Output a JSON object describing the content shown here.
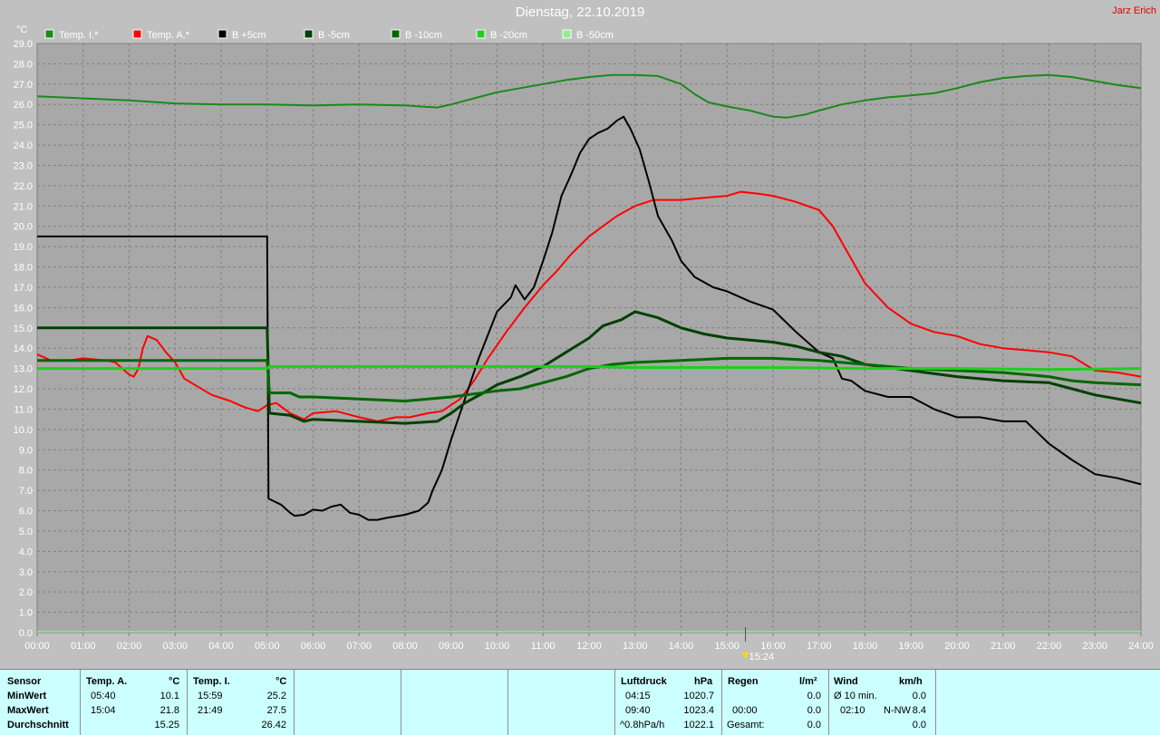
{
  "header": {
    "title": "Dienstag, 22.10.2019",
    "author": "Jarz Erich"
  },
  "colors": {
    "background": "#c0c0c0",
    "plot_bg": "#a8a8a8",
    "grid": "#808080",
    "stats_bg": "#ccffff"
  },
  "chart_data": {
    "type": "line",
    "y_unit": "°C",
    "ylim": [
      0,
      29
    ],
    "y_ticks": [
      "0.0",
      "1.0",
      "2.0",
      "3.0",
      "4.0",
      "5.0",
      "6.0",
      "7.0",
      "8.0",
      "9.0",
      "10.0",
      "11.0",
      "12.0",
      "13.0",
      "14.0",
      "15.0",
      "16.0",
      "17.0",
      "18.0",
      "19.0",
      "20.0",
      "21.0",
      "22.0",
      "23.0",
      "24.0",
      "25.0",
      "26.0",
      "27.0",
      "28.0",
      "29.0"
    ],
    "xlim": [
      0,
      24
    ],
    "x_ticks": [
      "00:00",
      "01:00",
      "02:00",
      "03:00",
      "04:00",
      "05:00",
      "06:00",
      "07:00",
      "08:00",
      "09:00",
      "10:00",
      "11:00",
      "12:00",
      "13:00",
      "14:00",
      "15:00",
      "16:00",
      "17:00",
      "18:00",
      "19:00",
      "20:00",
      "21:00",
      "22:00",
      "23:00",
      "24:00"
    ],
    "grid": true,
    "cursor": {
      "x": 15.4,
      "label": "15:24"
    },
    "legend": [
      {
        "name": "Temp. I.*",
        "color": "#1a8a1a"
      },
      {
        "name": "Temp. A.*",
        "color": "#ff0000"
      },
      {
        "name": "B +5cm",
        "color": "#000000"
      },
      {
        "name": "B -5cm",
        "color": "#004000"
      },
      {
        "name": "B -10cm",
        "color": "#006800"
      },
      {
        "name": "B -20cm",
        "color": "#1ecf1e"
      },
      {
        "name": "B -50cm",
        "color": "#90ee90"
      }
    ],
    "series": [
      {
        "name": "Temp. I.*",
        "color": "#1a8a1a",
        "width": 2,
        "points": [
          [
            0,
            26.4
          ],
          [
            0.5,
            26.35
          ],
          [
            1,
            26.3
          ],
          [
            2,
            26.2
          ],
          [
            3,
            26.05
          ],
          [
            4,
            26.0
          ],
          [
            5,
            26.0
          ],
          [
            6,
            25.95
          ],
          [
            7,
            26.0
          ],
          [
            8,
            25.95
          ],
          [
            8.7,
            25.85
          ],
          [
            9,
            26.0
          ],
          [
            9.5,
            26.3
          ],
          [
            10,
            26.6
          ],
          [
            10.5,
            26.8
          ],
          [
            11,
            27.0
          ],
          [
            11.5,
            27.2
          ],
          [
            12,
            27.35
          ],
          [
            12.5,
            27.45
          ],
          [
            13,
            27.45
          ],
          [
            13.5,
            27.4
          ],
          [
            14,
            27.0
          ],
          [
            14.3,
            26.5
          ],
          [
            14.6,
            26.1
          ],
          [
            15,
            25.9
          ],
          [
            15.5,
            25.7
          ],
          [
            16,
            25.4
          ],
          [
            16.3,
            25.35
          ],
          [
            16.7,
            25.5
          ],
          [
            17,
            25.7
          ],
          [
            17.5,
            26.0
          ],
          [
            18,
            26.2
          ],
          [
            18.5,
            26.35
          ],
          [
            19,
            26.45
          ],
          [
            19.5,
            26.55
          ],
          [
            20,
            26.8
          ],
          [
            20.5,
            27.1
          ],
          [
            21,
            27.3
          ],
          [
            21.5,
            27.4
          ],
          [
            22,
            27.45
          ],
          [
            22.5,
            27.35
          ],
          [
            23,
            27.15
          ],
          [
            23.5,
            26.95
          ],
          [
            24,
            26.8
          ]
        ]
      },
      {
        "name": "Temp. A.*",
        "color": "#ff0000",
        "width": 2,
        "points": [
          [
            0,
            13.7
          ],
          [
            0.3,
            13.4
          ],
          [
            0.7,
            13.4
          ],
          [
            1,
            13.5
          ],
          [
            1.5,
            13.4
          ],
          [
            1.7,
            13.3
          ],
          [
            2,
            12.7
          ],
          [
            2.1,
            12.6
          ],
          [
            2.2,
            13.0
          ],
          [
            2.3,
            14.0
          ],
          [
            2.4,
            14.6
          ],
          [
            2.6,
            14.4
          ],
          [
            2.8,
            13.8
          ],
          [
            3,
            13.3
          ],
          [
            3.2,
            12.5
          ],
          [
            3.5,
            12.1
          ],
          [
            3.8,
            11.7
          ],
          [
            4.2,
            11.4
          ],
          [
            4.5,
            11.1
          ],
          [
            4.8,
            10.9
          ],
          [
            5,
            11.2
          ],
          [
            5.2,
            11.3
          ],
          [
            5.5,
            10.8
          ],
          [
            5.8,
            10.5
          ],
          [
            6,
            10.8
          ],
          [
            6.5,
            10.9
          ],
          [
            7,
            10.6
          ],
          [
            7.4,
            10.4
          ],
          [
            7.8,
            10.6
          ],
          [
            8.1,
            10.6
          ],
          [
            8.5,
            10.8
          ],
          [
            8.8,
            10.9
          ],
          [
            9.2,
            11.5
          ],
          [
            9.5,
            12.4
          ],
          [
            9.8,
            13.5
          ],
          [
            10.2,
            14.8
          ],
          [
            10.6,
            16.0
          ],
          [
            11,
            17.1
          ],
          [
            11.3,
            17.8
          ],
          [
            11.6,
            18.6
          ],
          [
            12,
            19.5
          ],
          [
            12.3,
            20.0
          ],
          [
            12.6,
            20.5
          ],
          [
            13,
            21.0
          ],
          [
            13.4,
            21.3
          ],
          [
            14,
            21.3
          ],
          [
            14.5,
            21.4
          ],
          [
            15,
            21.5
          ],
          [
            15.3,
            21.7
          ],
          [
            15.7,
            21.6
          ],
          [
            16,
            21.5
          ],
          [
            16.5,
            21.2
          ],
          [
            17,
            20.8
          ],
          [
            17.3,
            20.0
          ],
          [
            17.6,
            18.8
          ],
          [
            18,
            17.2
          ],
          [
            18.5,
            16.0
          ],
          [
            19,
            15.2
          ],
          [
            19.5,
            14.8
          ],
          [
            20,
            14.6
          ],
          [
            20.5,
            14.2
          ],
          [
            21,
            14.0
          ],
          [
            21.5,
            13.9
          ],
          [
            22,
            13.8
          ],
          [
            22.5,
            13.6
          ],
          [
            23,
            12.9
          ],
          [
            23.5,
            12.8
          ],
          [
            24,
            12.6
          ]
        ]
      },
      {
        "name": "B +5cm",
        "color": "#000000",
        "width": 2,
        "points": [
          [
            0,
            19.5
          ],
          [
            5,
            19.5
          ],
          [
            5.03,
            6.6
          ],
          [
            5.3,
            6.3
          ],
          [
            5.5,
            5.9
          ],
          [
            5.6,
            5.75
          ],
          [
            5.8,
            5.8
          ],
          [
            6,
            6.05
          ],
          [
            6.2,
            6.0
          ],
          [
            6.4,
            6.2
          ],
          [
            6.6,
            6.3
          ],
          [
            6.8,
            5.9
          ],
          [
            7,
            5.8
          ],
          [
            7.2,
            5.55
          ],
          [
            7.4,
            5.55
          ],
          [
            7.6,
            5.65
          ],
          [
            8,
            5.8
          ],
          [
            8.3,
            6.0
          ],
          [
            8.5,
            6.4
          ],
          [
            8.6,
            7.0
          ],
          [
            8.8,
            8.0
          ],
          [
            9,
            9.5
          ],
          [
            9.3,
            11.5
          ],
          [
            9.6,
            13.5
          ],
          [
            10,
            15.8
          ],
          [
            10.3,
            16.5
          ],
          [
            10.4,
            17.1
          ],
          [
            10.6,
            16.4
          ],
          [
            10.8,
            17.0
          ],
          [
            11,
            18.3
          ],
          [
            11.2,
            19.7
          ],
          [
            11.4,
            21.5
          ],
          [
            11.6,
            22.5
          ],
          [
            11.8,
            23.6
          ],
          [
            12,
            24.3
          ],
          [
            12.2,
            24.6
          ],
          [
            12.4,
            24.8
          ],
          [
            12.6,
            25.2
          ],
          [
            12.75,
            25.4
          ],
          [
            12.9,
            24.8
          ],
          [
            13.1,
            23.8
          ],
          [
            13.3,
            22.2
          ],
          [
            13.5,
            20.5
          ],
          [
            13.8,
            19.3
          ],
          [
            14,
            18.3
          ],
          [
            14.3,
            17.5
          ],
          [
            14.7,
            17.0
          ],
          [
            15,
            16.8
          ],
          [
            15.5,
            16.3
          ],
          [
            16,
            15.9
          ],
          [
            16.5,
            14.8
          ],
          [
            17,
            13.8
          ],
          [
            17.3,
            13.5
          ],
          [
            17.5,
            12.5
          ],
          [
            17.7,
            12.4
          ],
          [
            18,
            11.9
          ],
          [
            18.5,
            11.6
          ],
          [
            19,
            11.6
          ],
          [
            19.5,
            11.0
          ],
          [
            20,
            10.6
          ],
          [
            20.5,
            10.6
          ],
          [
            21,
            10.4
          ],
          [
            21.5,
            10.4
          ],
          [
            22,
            9.3
          ],
          [
            22.5,
            8.5
          ],
          [
            23,
            7.8
          ],
          [
            23.5,
            7.6
          ],
          [
            24,
            7.3
          ]
        ]
      },
      {
        "name": "B -5cm",
        "color": "#004000",
        "width": 3,
        "points": [
          [
            0,
            15.0
          ],
          [
            5,
            15.0
          ],
          [
            5.05,
            10.8
          ],
          [
            5.5,
            10.7
          ],
          [
            5.8,
            10.4
          ],
          [
            6,
            10.5
          ],
          [
            7,
            10.4
          ],
          [
            8,
            10.3
          ],
          [
            8.7,
            10.4
          ],
          [
            9,
            10.8
          ],
          [
            9.3,
            11.3
          ],
          [
            9.7,
            11.8
          ],
          [
            10,
            12.2
          ],
          [
            10.5,
            12.6
          ],
          [
            11,
            13.1
          ],
          [
            11.5,
            13.8
          ],
          [
            12,
            14.5
          ],
          [
            12.3,
            15.1
          ],
          [
            12.7,
            15.4
          ],
          [
            13,
            15.8
          ],
          [
            13.5,
            15.5
          ],
          [
            14,
            15.0
          ],
          [
            14.5,
            14.7
          ],
          [
            15,
            14.5
          ],
          [
            16,
            14.3
          ],
          [
            16.5,
            14.1
          ],
          [
            17,
            13.8
          ],
          [
            17.5,
            13.6
          ],
          [
            18,
            13.2
          ],
          [
            19,
            12.9
          ],
          [
            20,
            12.6
          ],
          [
            21,
            12.4
          ],
          [
            22,
            12.3
          ],
          [
            22.5,
            12.0
          ],
          [
            23,
            11.7
          ],
          [
            23.5,
            11.5
          ],
          [
            24,
            11.3
          ]
        ]
      },
      {
        "name": "B -10cm",
        "color": "#006800",
        "width": 3,
        "points": [
          [
            0,
            13.4
          ],
          [
            5,
            13.4
          ],
          [
            5.05,
            11.8
          ],
          [
            5.5,
            11.8
          ],
          [
            5.7,
            11.6
          ],
          [
            6,
            11.6
          ],
          [
            7,
            11.5
          ],
          [
            8,
            11.4
          ],
          [
            9,
            11.6
          ],
          [
            10,
            11.9
          ],
          [
            10.5,
            12.0
          ],
          [
            11,
            12.3
          ],
          [
            11.5,
            12.6
          ],
          [
            12,
            13.0
          ],
          [
            12.5,
            13.2
          ],
          [
            13,
            13.3
          ],
          [
            14,
            13.4
          ],
          [
            15,
            13.5
          ],
          [
            16,
            13.5
          ],
          [
            17,
            13.4
          ],
          [
            18,
            13.2
          ],
          [
            19,
            13.0
          ],
          [
            20,
            12.9
          ],
          [
            21,
            12.8
          ],
          [
            22,
            12.6
          ],
          [
            22.5,
            12.4
          ],
          [
            23,
            12.3
          ],
          [
            24,
            12.2
          ]
        ]
      },
      {
        "name": "B -20cm",
        "color": "#1ecf1e",
        "width": 3,
        "points": [
          [
            0,
            13.0
          ],
          [
            5,
            13.0
          ],
          [
            5.05,
            13.1
          ],
          [
            8,
            13.1
          ],
          [
            11,
            13.1
          ],
          [
            12,
            13.1
          ],
          [
            13,
            13.05
          ],
          [
            14,
            13.05
          ],
          [
            16,
            13.05
          ],
          [
            18,
            13.0
          ],
          [
            20,
            13.0
          ],
          [
            22,
            12.95
          ],
          [
            24,
            13.0
          ]
        ]
      }
    ]
  },
  "stats": {
    "sensor": {
      "header": "Sensor",
      "rows": [
        "MinWert",
        "MaxWert",
        "Durchschnitt"
      ]
    },
    "temp_a": {
      "header": "Temp. A.",
      "unit": "°C",
      "min_time": "05:40",
      "min": "10.1",
      "max_time": "15:04",
      "max": "21.8",
      "avg": "15.25"
    },
    "temp_i": {
      "header": "Temp. I.",
      "unit": "°C",
      "min_time": "15:59",
      "min": "25.2",
      "max_time": "21:49",
      "max": "27.5",
      "avg": "26.42"
    },
    "pressure": {
      "header": "Luftdruck",
      "unit": "hPa",
      "r1_a": "04:15",
      "r1_b": "1020.7",
      "r2_a": "09:40",
      "r2_b": "1023.4",
      "r3_a": "^0.8hPa/h",
      "r3_b": "1022.1"
    },
    "rain": {
      "header": "Regen",
      "unit": "l/m²",
      "r2_a": "00:00",
      "r2_b": "0.0",
      "r3_a": "Gesamt:",
      "r3_b": "0.0",
      "r1_b": "0.0"
    },
    "wind": {
      "header": "Wind",
      "unit": "km/h",
      "r1_a": "Ø 10 min.",
      "r1_b": "0.0",
      "r2_a": "02:10",
      "r2_c": "N-NW",
      "r2_b": "8.4",
      "r3_b": "0.0"
    }
  }
}
